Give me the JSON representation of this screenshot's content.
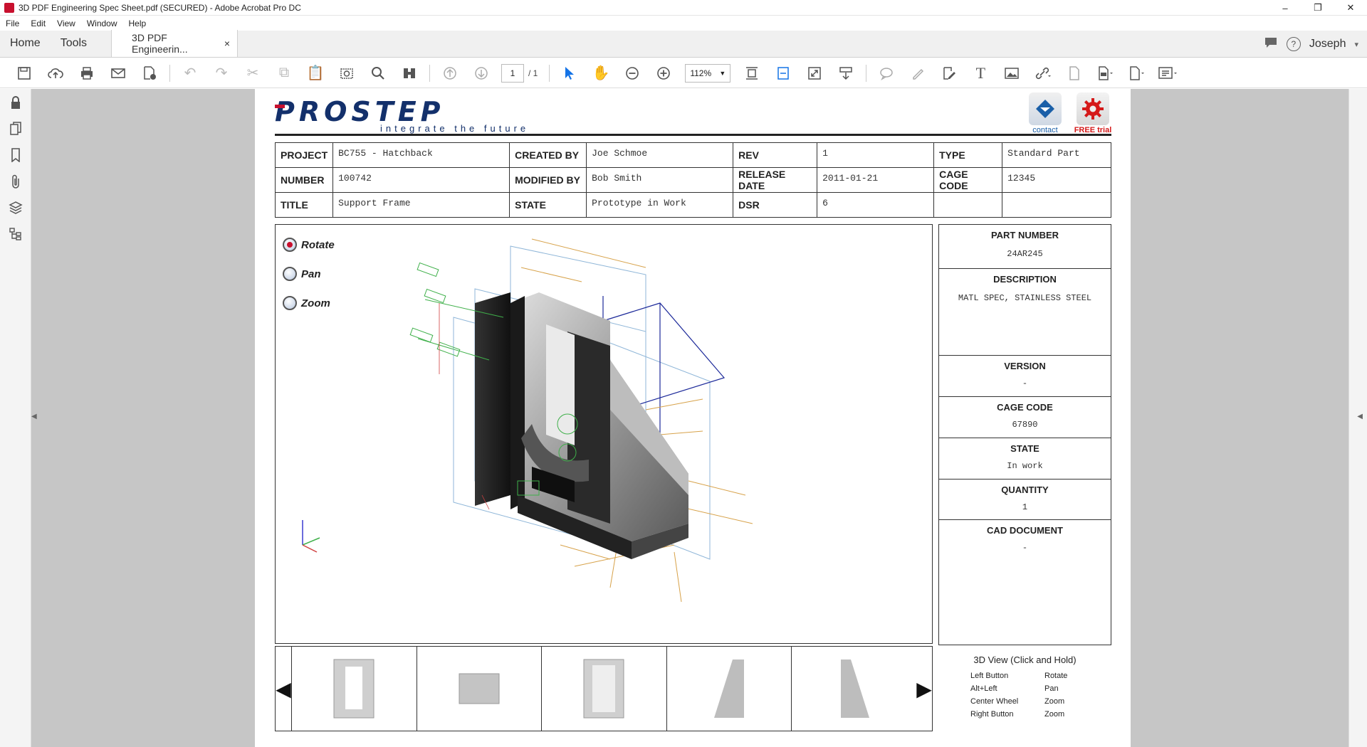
{
  "window": {
    "title": "3D PDF Engineering Spec Sheet.pdf (SECURED) - Adobe Acrobat Pro DC",
    "controls": [
      "–",
      "❐",
      "✕"
    ]
  },
  "menu": [
    "File",
    "Edit",
    "View",
    "Window",
    "Help"
  ],
  "tabs": {
    "home": "Home",
    "tools": "Tools",
    "doc": "3D PDF Engineerin...",
    "doc_close": "×",
    "user": "Joseph"
  },
  "toolbar": {
    "page_current": "1",
    "page_total": "/ 1",
    "zoom": "112%"
  },
  "header": {
    "logo_text": "PROSTEP",
    "logo_tagline": "integrate the future",
    "contact_label": "contact",
    "trial_label": "FREE trial"
  },
  "meta": {
    "rows": [
      [
        {
          "k": "PROJECT",
          "v": "BC755 - Hatchback"
        },
        {
          "k": "CREATED BY",
          "v": "Joe Schmoe"
        },
        {
          "k": "REV",
          "v": "1"
        },
        {
          "k": "TYPE",
          "v": "Standard Part"
        }
      ],
      [
        {
          "k": "NUMBER",
          "v": "100742"
        },
        {
          "k": "MODIFIED BY",
          "v": "Bob Smith"
        },
        {
          "k": "RELEASE DATE",
          "v": "2011-01-21"
        },
        {
          "k": "CAGE CODE",
          "v": "12345"
        }
      ],
      [
        {
          "k": "TITLE",
          "v": "Support Frame"
        },
        {
          "k": "STATE",
          "v": "Prototype in Work"
        },
        {
          "k": "DSR",
          "v": "6"
        },
        {
          "k": "",
          "v": ""
        }
      ]
    ]
  },
  "viewer": {
    "modes": [
      {
        "label": "Rotate",
        "selected": true
      },
      {
        "label": "Pan",
        "selected": false
      },
      {
        "label": "Zoom",
        "selected": false
      }
    ]
  },
  "properties": [
    {
      "label": "PART NUMBER",
      "value": "24AR245"
    },
    {
      "label": "DESCRIPTION",
      "value": "MATL SPEC, STAINLESS STEEL"
    },
    {
      "label": "VERSION",
      "value": "-"
    },
    {
      "label": "CAGE CODE",
      "value": "67890"
    },
    {
      "label": "STATE",
      "value": "In work"
    },
    {
      "label": "QUANTITY",
      "value": "1"
    },
    {
      "label": "CAD DOCUMENT",
      "value": "-"
    }
  ],
  "help": {
    "title": "3D View (Click and Hold)",
    "rows": [
      {
        "input": "Left Button",
        "action": "Rotate"
      },
      {
        "input": "Alt+Left",
        "action": "Pan"
      },
      {
        "input": "Center Wheel",
        "action": "Zoom"
      },
      {
        "input": "Right Button",
        "action": "Zoom"
      }
    ]
  }
}
